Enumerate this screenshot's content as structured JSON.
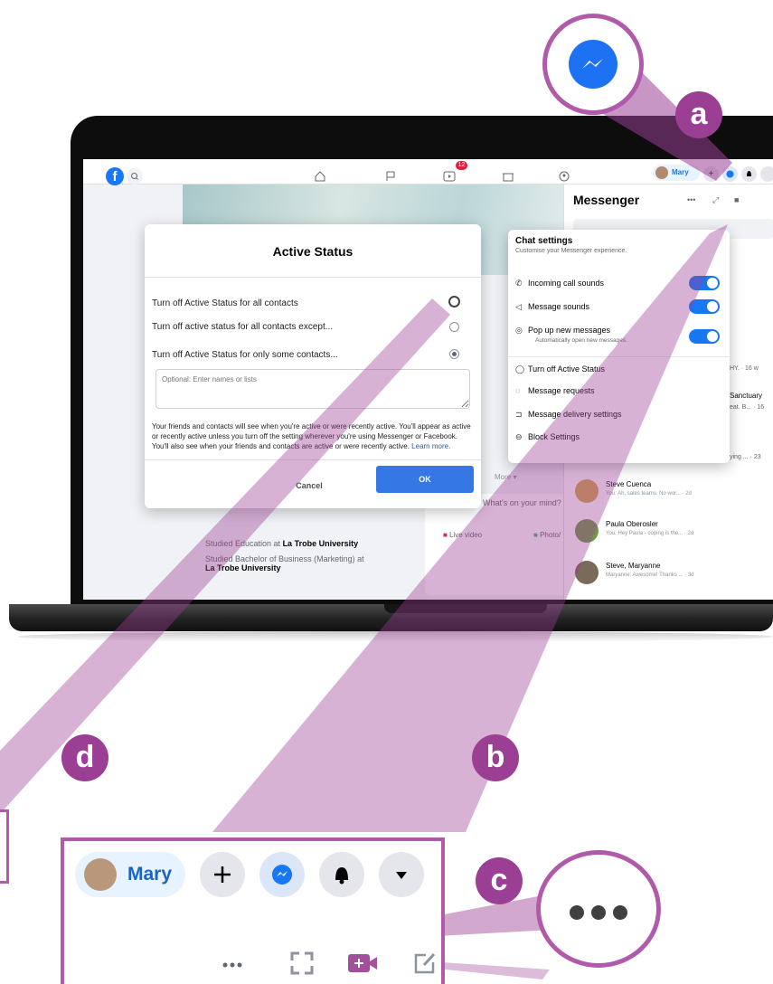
{
  "topbar": {
    "user_name": "Mary",
    "notification_count": "12"
  },
  "dialog": {
    "title": "Active Status",
    "options": [
      "Turn off Active Status for all contacts",
      "Turn off active status for all contacts except...",
      "Turn off Active Status for only some contacts..."
    ],
    "selected_option_index": 2,
    "names_placeholder": "Optional: Enter names or lists",
    "description": "Your friends and contacts will see when you're active or were recently active. You'll appear as active or recently active unless you turn off the setting wherever you're using Messenger or Facebook. You'll also see when your friends and contacts are active or were recently active.",
    "learn_more": "Learn more.",
    "cancel_label": "Cancel",
    "ok_label": "OK"
  },
  "messenger": {
    "title": "Messenger",
    "chats": [
      {
        "name": "Steve Cuenca",
        "preview": "You: Ah, sales teams. No wor... · 2d"
      },
      {
        "name": "Paula Oberosler",
        "preview": "You: Hey Paula - coping is the... · 2d"
      },
      {
        "name": "Steve, Maryanne",
        "preview": "Maryanne: Awesome! Thanks ... · 3d"
      }
    ],
    "partial_texts": [
      "HY. · 16 w",
      "Sanctuary",
      "eat. B... · 16",
      "ying ... · 23"
    ]
  },
  "chat_settings": {
    "title": "Chat settings",
    "subtitle": "Customise your Messenger experience.",
    "toggles": [
      {
        "label": "Incoming call sounds",
        "on": true
      },
      {
        "label": "Message sounds",
        "on": true
      },
      {
        "label": "Pop up new messages",
        "sub": "Automatically open new messages.",
        "on": true
      }
    ],
    "actions": [
      "Turn off Active Status",
      "Message requests",
      "Message delivery settings",
      "Block Settings"
    ]
  },
  "profile": {
    "line1_prefix": "Studied Education at ",
    "line1_place": "La Trobe University",
    "line2_prefix": "Studied Bachelor of Business (Marketing) at ",
    "line2_place": "La Trobe University",
    "more_label": "More ▾",
    "post_prompt": "What's on your mind?",
    "live_video": "Live video",
    "photo": "Photo/"
  },
  "callouts": {
    "a": "a",
    "b": "b",
    "c": "c",
    "d": "d"
  },
  "zoom_toolbar": {
    "user_name": "Mary"
  },
  "colors": {
    "accent_purple": "#9b3f95",
    "fb_blue": "#1877f2"
  }
}
